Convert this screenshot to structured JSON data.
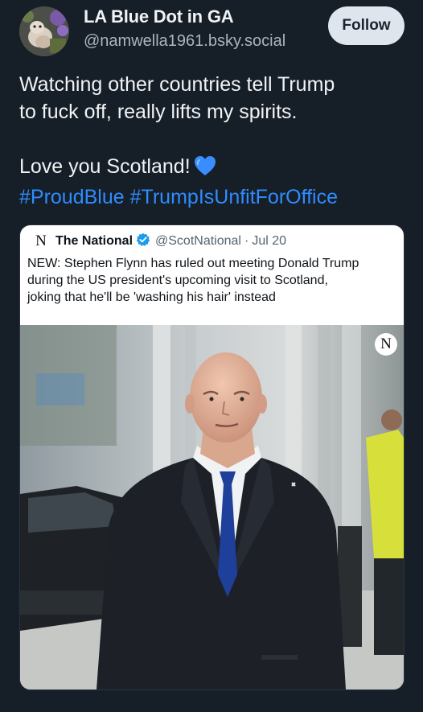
{
  "author": {
    "display_name": "LA Blue Dot in GA",
    "handle": "@namwella1961.bsky.social",
    "avatar_icon": "avatar-photo-icon"
  },
  "follow_label": "Follow",
  "post": {
    "line1": "Watching other countries tell Trump",
    "line2": "to fuck off, really lifts my spirits.",
    "line3": "Love you Scotland!",
    "heart_icon": "blue-heart-icon",
    "hashtags": [
      "#ProudBlue",
      "#TrumpIsUnfitForOffice"
    ]
  },
  "quote": {
    "logo": "N",
    "name": "The National",
    "handle": "@ScotNational",
    "separator": "·",
    "date": "Jul 20",
    "text_lines": [
      "NEW: Stephen Flynn has ruled out meeting Donald Trump",
      "during the US president's upcoming visit to Scotland,",
      "joking that he'll be 'washing his hair' instead"
    ],
    "photo_logo": "N"
  },
  "colors": {
    "background": "#161e27",
    "link": "#2f8cff",
    "verified": "#1d9bf0"
  }
}
